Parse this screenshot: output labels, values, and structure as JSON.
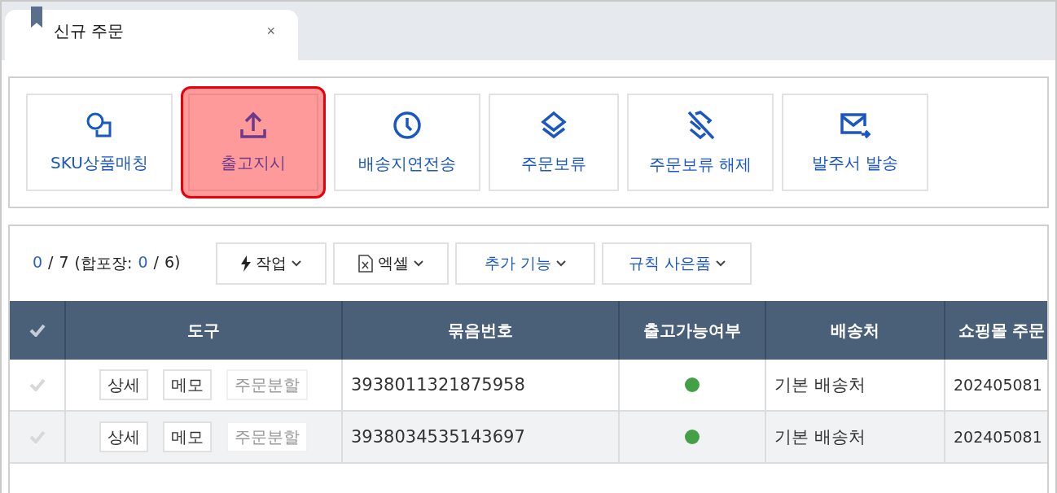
{
  "tab": {
    "label": "신규 주문",
    "close": "×",
    "selected": true
  },
  "actions": [
    {
      "kind": "match",
      "label": "SKU상품매칭",
      "highlighted": false
    },
    {
      "kind": "upload",
      "label": "출고지시",
      "highlighted": true
    },
    {
      "kind": "clock",
      "label": "배송지연전송",
      "highlighted": false
    },
    {
      "kind": "layers",
      "label": "주문보류",
      "highlighted": false
    },
    {
      "kind": "layers-off",
      "label": "주문보류 해제",
      "highlighted": false
    },
    {
      "kind": "mail",
      "label": "발주서 발송",
      "highlighted": false
    }
  ],
  "summary": {
    "selected": "0",
    "sep1": "/",
    "total": "7",
    "open": "(합포장:",
    "bundle_selected": "0",
    "sep2": "/",
    "bundle_total": "6)"
  },
  "menus": [
    {
      "kind": "bolt",
      "label": "작업"
    },
    {
      "kind": "excel",
      "label": "엑셀"
    },
    {
      "kind": "none",
      "label": "추가 기능"
    },
    {
      "kind": "none",
      "label": "규칙 사은품"
    }
  ],
  "table": {
    "columns": [
      "도구",
      "묶음번호",
      "출고가능여부",
      "배송처",
      "쇼핑몰 주문"
    ],
    "rows": [
      {
        "checked": false,
        "tools": [
          {
            "label": "상세",
            "disabled": false
          },
          {
            "label": "메모",
            "disabled": false
          },
          {
            "label": "주문분할",
            "disabled": true
          }
        ],
        "bundle_no": "3938011321875958",
        "color": "#43a047",
        "shipping": "기본 배송처",
        "shop_order": "202405081"
      },
      {
        "checked": false,
        "tools": [
          {
            "label": "상세",
            "disabled": false
          },
          {
            "label": "메모",
            "disabled": false
          },
          {
            "label": "주문분할",
            "disabled": true
          }
        ],
        "bundle_no": "3938034535143697",
        "color": "#43a047",
        "shipping": "기본 배송처",
        "shop_order": "202405081"
      }
    ]
  }
}
